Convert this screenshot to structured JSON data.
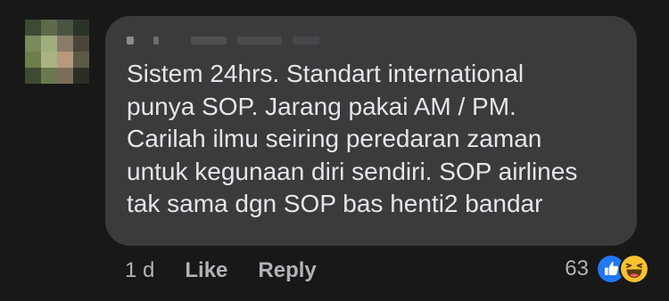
{
  "comment": {
    "text": "Sistem 24hrs. Standart international\npunya SOP. Jarang pakai AM / PM.\nCarilah ilmu seiring peredaran zaman\nuntuk kegunaan diri sendiri. SOP airlines\ntak sama dgn SOP bas henti2 bandar"
  },
  "actions": {
    "time": "1 d",
    "like_label": "Like",
    "reply_label": "Reply"
  },
  "reactions": {
    "count": "63",
    "types": [
      "like-icon",
      "haha-icon"
    ]
  },
  "colors": {
    "background": "#181818",
    "bubble": "#3a3b3c",
    "text": "#e4e6eb",
    "secondary_text": "#b0b3b8",
    "like_blue": "#2078f4",
    "haha_yellow": "#f7c130"
  }
}
